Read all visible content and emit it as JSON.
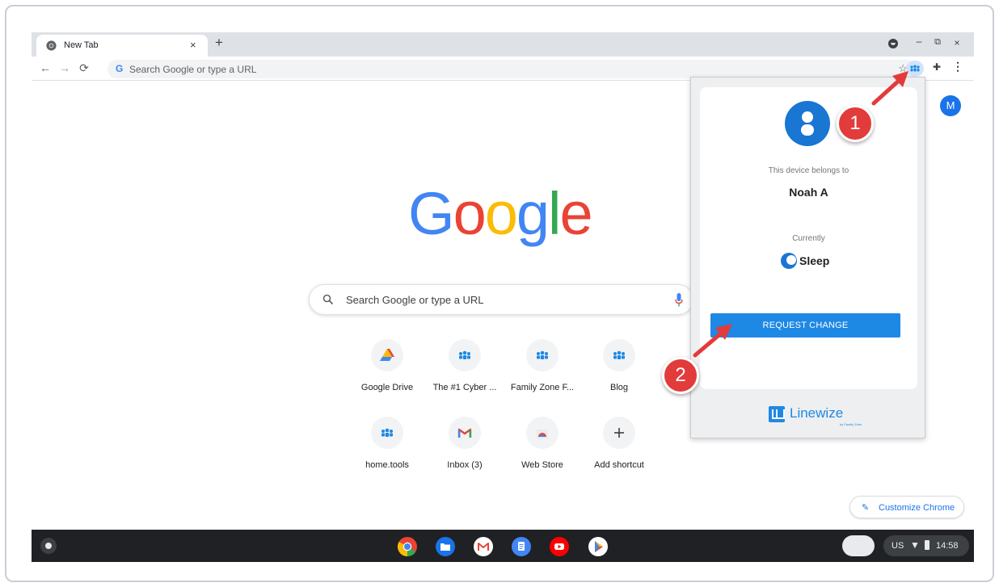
{
  "browser": {
    "tab_title": "New Tab",
    "tab_close": "×",
    "new_tab": "+",
    "omnibox_placeholder": "Search Google or type a URL",
    "window_controls": {
      "minimize": "–",
      "restore": "⧉",
      "close": "×"
    }
  },
  "new_tab_page": {
    "avatar_initial": "M",
    "logo_letters": [
      "G",
      "o",
      "o",
      "g",
      "l",
      "e"
    ],
    "logo_colors": [
      "#4285f4",
      "#ea4335",
      "#fbbc05",
      "#4285f4",
      "#34a853",
      "#ea4335"
    ],
    "search_placeholder": "Search Google or type a URL",
    "shortcuts": [
      {
        "label": "Google Drive",
        "icon": "google-drive-icon"
      },
      {
        "label": "The #1 Cyber ...",
        "icon": "linewize-icon"
      },
      {
        "label": "Family Zone F...",
        "icon": "linewize-icon"
      },
      {
        "label": "Blog",
        "icon": "linewize-icon"
      },
      {
        "label": "home.tools",
        "icon": "linewize-icon"
      },
      {
        "label": "Inbox (3)",
        "icon": "gmail-icon"
      },
      {
        "label": "Web Store",
        "icon": "web-store-icon"
      },
      {
        "label": "Add shortcut",
        "icon": "plus-icon"
      }
    ],
    "customize_label": "Customize Chrome"
  },
  "popup": {
    "belongs_label": "This device belongs to",
    "owner_name": "Noah A",
    "currently_label": "Currently",
    "mode": "Sleep",
    "request_button": "REQUEST CHANGE",
    "brand": "Linewize",
    "brand_sub": "by Family Zone",
    "accent_color": "#1e88e5"
  },
  "annotations": {
    "callout_1": "1",
    "callout_2": "2",
    "color": "#e23b3b"
  },
  "shelf": {
    "apps": [
      "chrome-icon",
      "files-icon",
      "gmail-icon",
      "docs-icon",
      "youtube-icon",
      "play-store-icon"
    ],
    "tray": {
      "locale": "US",
      "time": "14:58"
    }
  }
}
